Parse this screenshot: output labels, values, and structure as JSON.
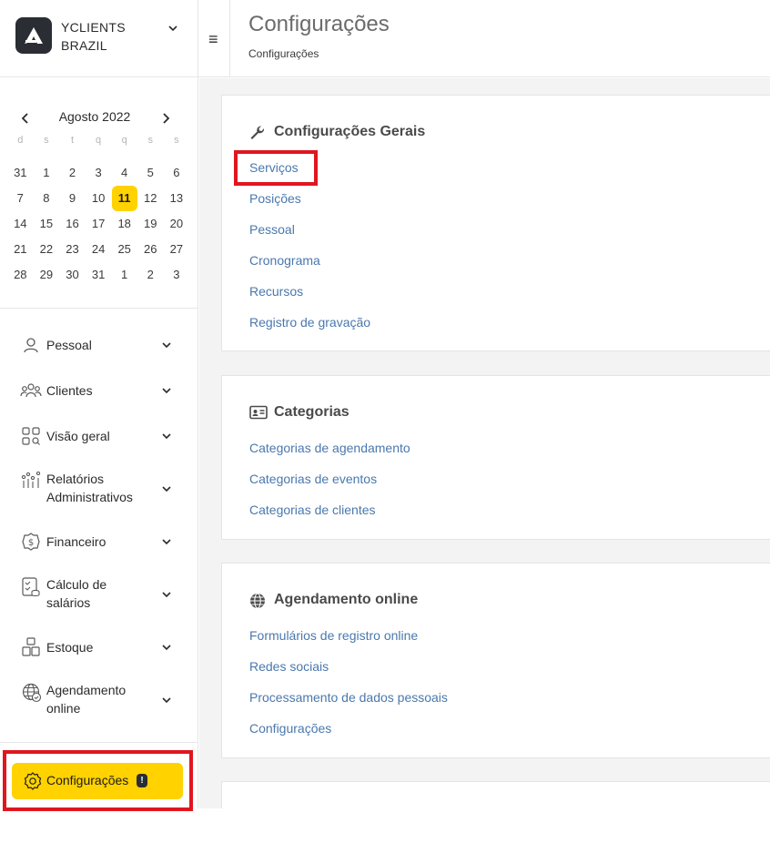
{
  "brand": {
    "name_line1": "YCLIENTS",
    "name_line2": "BRAZIL"
  },
  "calendar": {
    "month_label": "Agosto 2022",
    "weekdays": [
      "d",
      "s",
      "t",
      "q",
      "q",
      "s",
      "s"
    ],
    "weeks": [
      [
        "31",
        "1",
        "2",
        "3",
        "4",
        "5",
        "6"
      ],
      [
        "7",
        "8",
        "9",
        "10",
        "11",
        "12",
        "13"
      ],
      [
        "14",
        "15",
        "16",
        "17",
        "18",
        "19",
        "20"
      ],
      [
        "21",
        "22",
        "23",
        "24",
        "25",
        "26",
        "27"
      ],
      [
        "28",
        "29",
        "30",
        "31",
        "1",
        "2",
        "3"
      ]
    ],
    "selected_day": "11"
  },
  "nav": {
    "items": [
      {
        "label": "Pessoal",
        "icon": "person-icon"
      },
      {
        "label": "Clientes",
        "icon": "clients-icon"
      },
      {
        "label": "Visão geral",
        "icon": "overview-icon"
      },
      {
        "label": "Relatórios Administrativos",
        "label_line1": "Relatórios",
        "label_line2": "Administrativos",
        "icon": "reports-icon"
      },
      {
        "label": "Financeiro",
        "icon": "finance-icon"
      },
      {
        "label": "Cálculo de salários",
        "label_line1": "Cálculo de",
        "label_line2": "salários",
        "icon": "salary-icon"
      },
      {
        "label": "Estoque",
        "icon": "stock-icon"
      },
      {
        "label": "Agendamento online",
        "label_line1": "Agendamento",
        "label_line2": "online",
        "icon": "online-booking-icon"
      }
    ],
    "settings": {
      "label": "Configurações",
      "badge": "!"
    }
  },
  "header": {
    "title": "Configurações",
    "breadcrumb": "Configurações",
    "menu_glyph": "≡"
  },
  "sections": [
    {
      "title": "Configurações Gerais",
      "icon": "wrench-icon",
      "links": [
        "Serviços",
        "Posições",
        "Pessoal",
        "Cronograma",
        "Recursos",
        "Registro de gravação"
      ]
    },
    {
      "title": "Categorias",
      "icon": "id-card-icon",
      "links": [
        "Categorias de agendamento",
        "Categorias de eventos",
        "Categorias de clientes"
      ]
    },
    {
      "title": "Agendamento online",
      "icon": "globe-icon",
      "links": [
        "Formulários de registro online",
        "Redes sociais",
        "Processamento de dados pessoais",
        "Configurações"
      ]
    }
  ],
  "colors": {
    "accent": "#ffd200",
    "link": "#4a78ad",
    "highlight": "#e0161f",
    "background": "#f3f3f4"
  }
}
